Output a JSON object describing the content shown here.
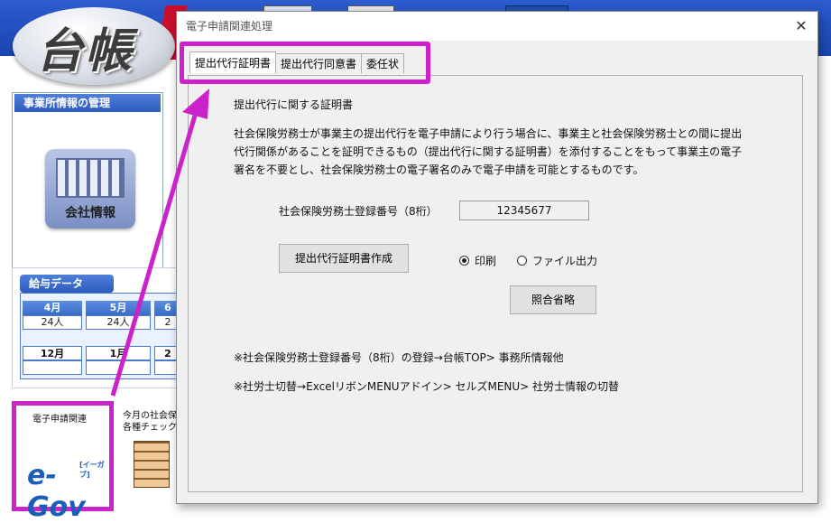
{
  "background_app": {
    "logo_text": "台帳",
    "office_panel_title": "事業所情報の管理",
    "company_button_label": "会社情報",
    "salary_panel_title": "給与データ",
    "salary_grid": {
      "row1_months": [
        "4月",
        "5月",
        "6"
      ],
      "row1_counts": [
        "24人",
        "24人",
        "2"
      ],
      "row2_months": [
        "12月",
        "1月",
        "2"
      ]
    },
    "egov_tile_label": "電子申請関連",
    "egov_logo_text": "e-Gov",
    "egov_logo_sub": "[イーガブ]",
    "check_tile_label_line1": "今月の社会保",
    "check_tile_label_line2": "各種チェック"
  },
  "dialog": {
    "title": "電子申請関連処理",
    "close_glyph": "✕",
    "tabs": [
      {
        "label": "提出代行証明書",
        "active": true
      },
      {
        "label": "提出代行同意書",
        "active": false
      },
      {
        "label": "委任状",
        "active": false
      }
    ],
    "heading": "提出代行に関する証明書",
    "description_lines": [
      "社会保険労務士が事業主の提出代行を電子申請により行う場合に、事業主と社会保険労務士との間に提出",
      "代行関係があることを証明できるもの（提出代行に関する証明書）を添付することをもって事業主の電子",
      "署名を不要とし、社会保険労務士の電子署名のみで電子申請を可能とするものです。"
    ],
    "reg_number_label": "社会保険労務士登録番号（8桁）",
    "reg_number_value": "12345677",
    "create_button_label": "提出代行証明書作成",
    "output_options": [
      {
        "label": "印刷",
        "checked": true
      },
      {
        "label": "ファイル出力",
        "checked": false
      }
    ],
    "skip_check_button_label": "照合省略",
    "note1": "※社会保険労務士登録番号（8桁）の登録→台帳TOP> 事務所情報他",
    "note2": "※社労士切替→ExcelリボンMENUアドイン> セルズMENU> 社労士情報の切替"
  },
  "annotation": {
    "highlight_color": "#cc22cc"
  }
}
